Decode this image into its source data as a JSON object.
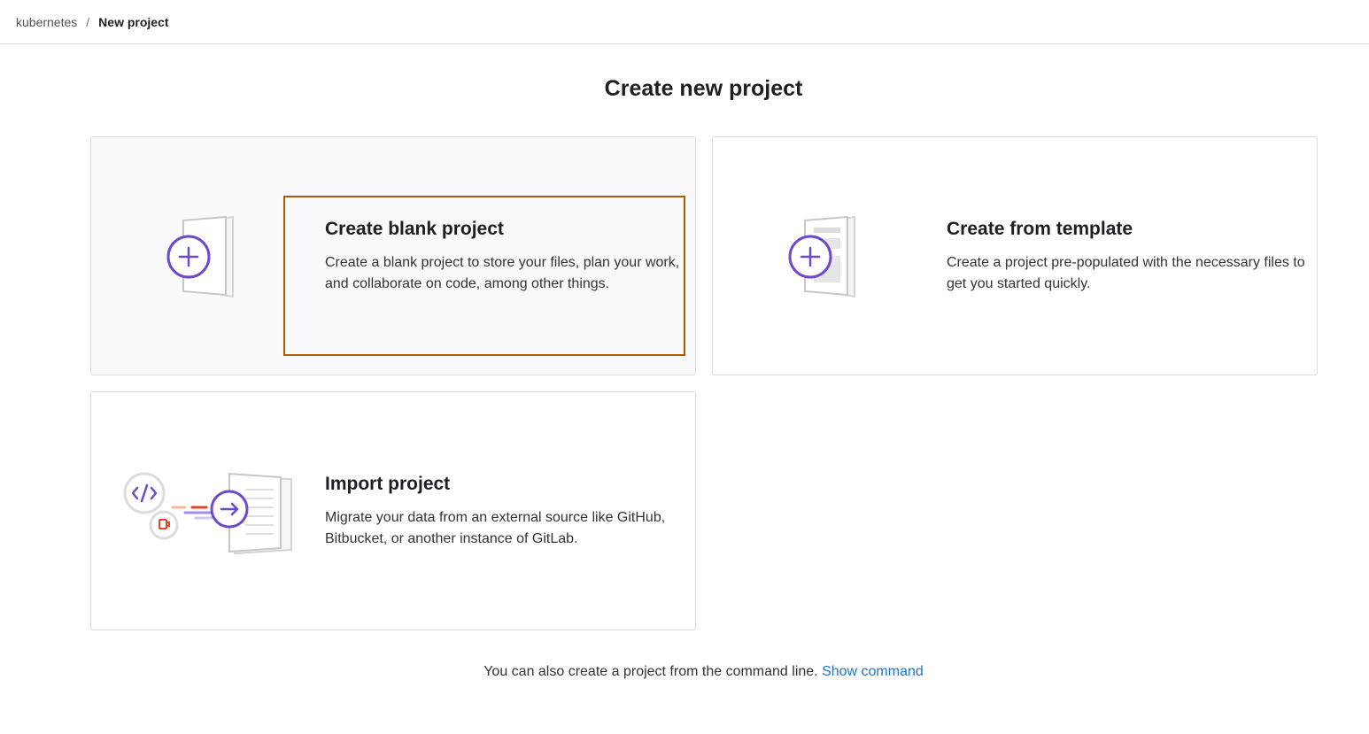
{
  "breadcrumb": {
    "parent": "kubernetes",
    "separator": "/",
    "current": "New project"
  },
  "page": {
    "title": "Create new project"
  },
  "cards": [
    {
      "title": "Create blank project",
      "description": "Create a blank project to store your files, plan your work, and collaborate on code, among other things.",
      "icon": "blank-project-icon"
    },
    {
      "title": "Create from template",
      "description": "Create a project pre-populated with the necessary files to get you started quickly.",
      "icon": "template-project-icon"
    },
    {
      "title": "Import project",
      "description": "Migrate your data from an external source like GitHub, Bitbucket, or another instance of GitLab.",
      "icon": "import-project-icon"
    }
  ],
  "footer": {
    "text": "You can also create a project from the command line.",
    "link_label": "Show command"
  },
  "colors": {
    "accent_purple": "#6e49cb",
    "focus_ring": "#ad5d00",
    "link": "#1f75cb",
    "orange_accent": "#e24329"
  }
}
